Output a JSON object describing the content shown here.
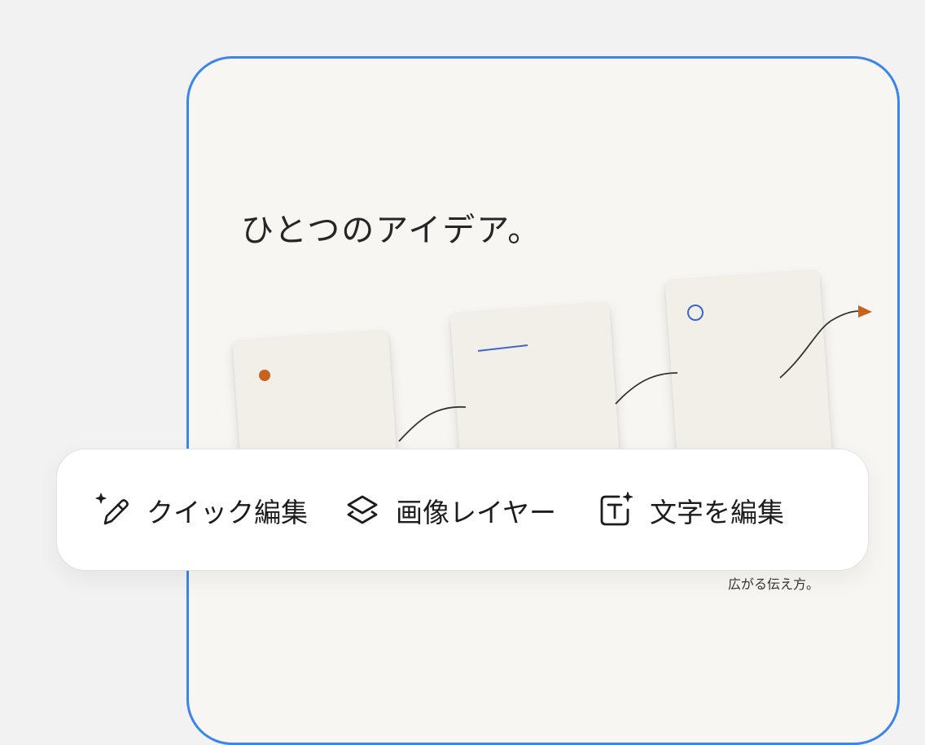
{
  "hero": {
    "headline": "ひとつのアイデア。",
    "caption": "広がる伝え方。"
  },
  "toolbar": {
    "items": [
      {
        "label": "クイック編集",
        "icon": "sparkle-pencil-icon"
      },
      {
        "label": "画像レイヤー",
        "icon": "layers-icon"
      },
      {
        "label": "文字を編集",
        "icon": "text-sparkle-icon"
      }
    ]
  },
  "colors": {
    "frame_border": "#3d84ec",
    "accent_orange": "#c8621e",
    "accent_blue": "#3a67d1",
    "background": "#f2f2f2",
    "card_bg": "#f8f6f2"
  }
}
